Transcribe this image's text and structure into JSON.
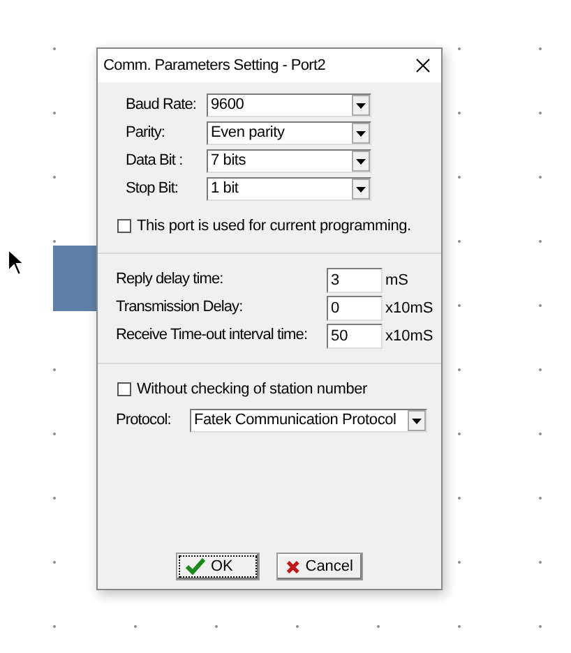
{
  "window": {
    "title": "Comm. Parameters Setting - Port2"
  },
  "serial_settings": [
    {
      "label": "Baud Rate:",
      "value": "9600"
    },
    {
      "label": "Parity:",
      "value": "Even parity"
    },
    {
      "label": "Data Bit :",
      "value": "7 bits"
    },
    {
      "label": "Stop Bit:",
      "value": "1 bit"
    }
  ],
  "current_programming": {
    "label": "This port is used for current programming.",
    "checked": false
  },
  "timing": [
    {
      "label": "Reply delay time:",
      "value": "3",
      "unit": "mS"
    },
    {
      "label": "Transmission Delay:",
      "value": "0",
      "unit": "x10mS"
    },
    {
      "label": "Receive Time-out interval time:",
      "value": "50",
      "unit": "x10mS"
    }
  ],
  "station_check": {
    "label": "Without checking of station number",
    "checked": false
  },
  "protocol": {
    "label": "Protocol:",
    "value": "Fatek Communication Protocol"
  },
  "buttons": [
    {
      "label": "OK",
      "kind": "ok",
      "focused": true
    },
    {
      "label": "Cancel",
      "kind": "cancel",
      "focused": false
    }
  ]
}
